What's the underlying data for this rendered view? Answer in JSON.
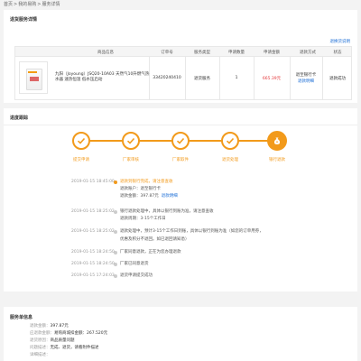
{
  "breadcrumb": {
    "home": "首页",
    "my_orders": "我的易购",
    "current": "服务详情",
    "sep": ">"
  },
  "order": {
    "title": "退货服务详情",
    "return_link": "退换货说明",
    "headers": [
      "商品信息",
      "订单号",
      "服务类型",
      "申请数量",
      "申请金额",
      "退款方式",
      "状态"
    ],
    "product_name": "九阳（Joyoung）JSQ20-10A03 天然气10升燃气热水器 速热恒温 低水压启动",
    "order_no": "33420240410",
    "service_type": "退货服务",
    "qty": "1",
    "amount": "665.39元",
    "refund_method": "退至银行卡",
    "refund_link": "退款明细",
    "status": "退款成功"
  },
  "progress": {
    "title": "进度跟踪",
    "steps": [
      "提交申请",
      "厂家审核",
      "厂家取件",
      "退货处理",
      "银行退款"
    ],
    "timeline": [
      {
        "time": "2019-01-15 18:45:00",
        "lines": [
          "退款到银行完成，请注意查收"
        ],
        "account_label": "退款账户：",
        "account": "退至银行卡",
        "amount_label": "退款金额：",
        "amount": "397.87元",
        "detail_link": "退款明细"
      },
      {
        "time": "2019-01-15 18:25:02",
        "lines": [
          "银行退款处理中，具体以银行到账为准，请注意查收",
          "退款周期：3-15个工作日"
        ]
      },
      {
        "time": "2019-01-15 18:25:02",
        "lines": [
          "退款处理中，预计3-15个工作日到账，具体以银行到账为准（如您的订单用券，",
          "优惠及积分不退回。如已退回请知悉）"
        ]
      },
      {
        "time": "2019-01-15 18:24:50",
        "lines": [
          "厂家同意退款，正在为您办理退款"
        ]
      },
      {
        "time": "2019-01-15 18:24:50",
        "lines": [
          "厂家已同意退货"
        ]
      },
      {
        "time": "2019-01-15 17:24:03",
        "lines": [
          "退货申请提交成功"
        ]
      }
    ]
  },
  "service": {
    "title": "服务单信息",
    "rows": [
      {
        "k": "退款金额：",
        "v": "397.87元"
      },
      {
        "k": "应退款金额：",
        "v": "易购商城扣金额：267.520元"
      },
      {
        "k": "退货原因：",
        "v": "商品质量问题"
      },
      {
        "k": "问题描述：",
        "v": "无成、退货，请看附件描述"
      },
      {
        "k": "详细描述：",
        "v": ""
      }
    ]
  },
  "colors": {
    "accent": "#f29a1b",
    "link": "#1e6fd6",
    "price": "#e4393c"
  }
}
